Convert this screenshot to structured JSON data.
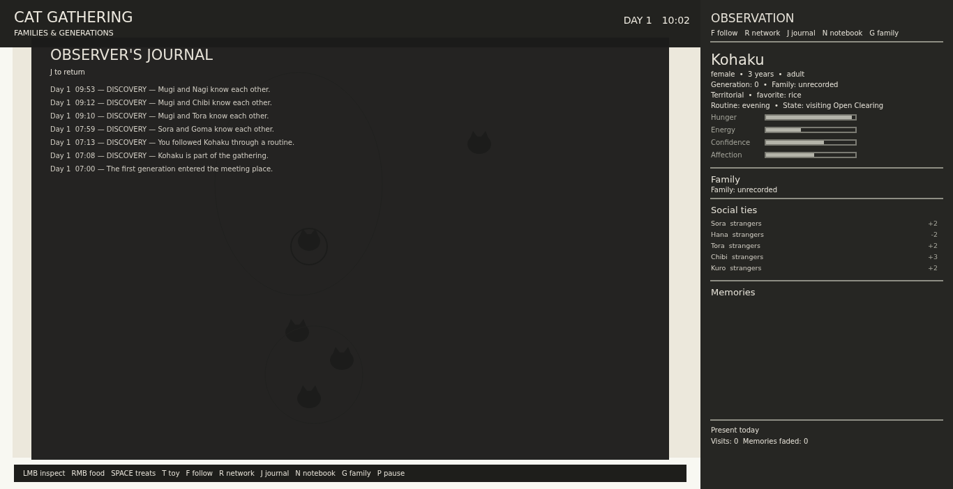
{
  "header": {
    "title": "CAT GATHERING",
    "subtitle": "FAMILIES & GENERATIONS",
    "day": "DAY 1",
    "time": "10:02"
  },
  "journal": {
    "title": "OBSERVER'S JOURNAL",
    "hint": "J to return",
    "entries": [
      "Day 1  09:53 — DISCOVERY — Mugi and Nagi know each other.",
      "Day 1  09:12 — DISCOVERY — Mugi and Chibi know each other.",
      "Day 1  09:10 — DISCOVERY — Mugi and Tora know each other.",
      "Day 1  07:59 — DISCOVERY — Sora and Goma know each other.",
      "Day 1  07:13 — DISCOVERY — You followed Kohaku through a routine.",
      "Day 1  07:08 — DISCOVERY — Kohaku is part of the gathering.",
      "Day 1  07:00 — The first generation entered the meeting place."
    ]
  },
  "controls_bar": [
    "LMB inspect",
    "RMB food",
    "SPACE treats",
    "T toy",
    "F follow",
    "R network",
    "J journal",
    "N notebook",
    "G family",
    "P pause"
  ],
  "panel": {
    "title": "OBSERVATION",
    "shortcuts": [
      "F follow",
      "R network",
      "J journal",
      "N notebook",
      "G family"
    ],
    "cat": {
      "name": "Kohaku",
      "details": [
        "female  •  3 years  •  adult",
        "Generation: 0  •  Family: unrecorded",
        "Territorial  •  favorite: rice",
        "Routine: evening  •  State: visiting Open Clearing"
      ],
      "stats": [
        {
          "label": "Hunger",
          "level": 0.96
        },
        {
          "label": "Energy",
          "level": 0.39
        },
        {
          "label": "Confidence",
          "level": 0.65
        },
        {
          "label": "Affection",
          "level": 0.54
        }
      ]
    },
    "family": {
      "title": "Family",
      "text": "Family: unrecorded"
    },
    "social_ties": {
      "title": "Social ties",
      "ties": [
        {
          "name": "Sora",
          "relation": "strangers",
          "value": "+2"
        },
        {
          "name": "Hana",
          "relation": "strangers",
          "value": "-2"
        },
        {
          "name": "Tora",
          "relation": "strangers",
          "value": "+2"
        },
        {
          "name": "Chibi",
          "relation": "strangers",
          "value": "+3"
        },
        {
          "name": "Kuro",
          "relation": "strangers",
          "value": "+2"
        }
      ]
    },
    "memories": {
      "title": "Memories"
    },
    "footer": {
      "title": "Present today",
      "text": "Visits: 0  Memories faded: 0"
    }
  }
}
